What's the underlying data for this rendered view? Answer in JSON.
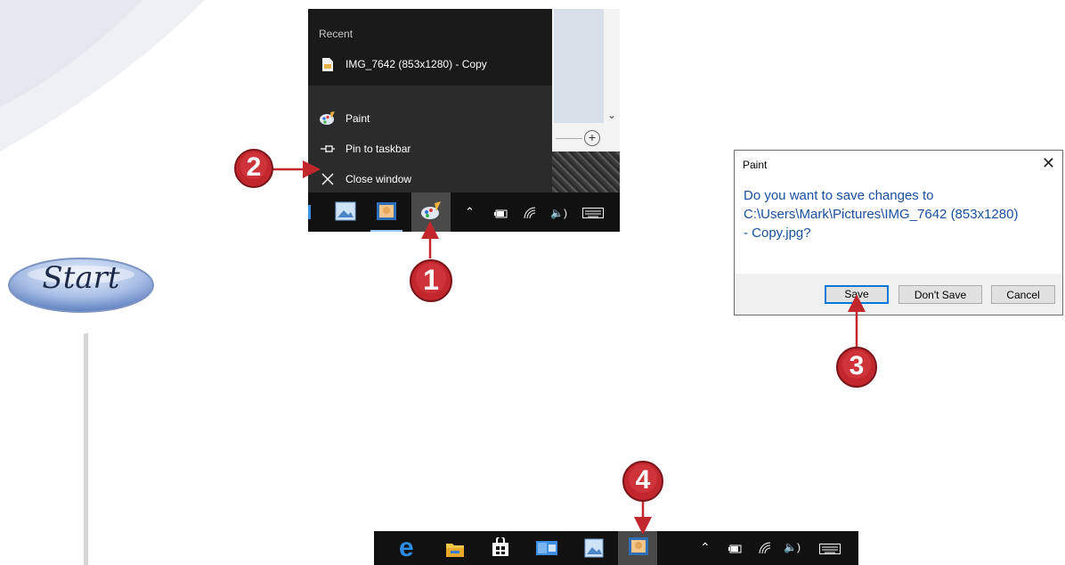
{
  "start_badge": {
    "label": "Start"
  },
  "jump_list": {
    "section_title": "Recent",
    "recent_file": "IMG_7642 (853x1280) - Copy",
    "app_name": "Paint",
    "pin_label": "Pin to taskbar",
    "close_label": "Close window"
  },
  "dialog": {
    "title": "Paint",
    "message_line1": "Do you want to save changes to",
    "message_line2": "C:\\Users\\Mark\\Pictures\\IMG_7642 (853x1280)",
    "message_line3": "- Copy.jpg?",
    "save_label": "Save",
    "dont_save_label": "Don't Save",
    "cancel_label": "Cancel"
  },
  "callouts": [
    "1",
    "2",
    "3",
    "4"
  ],
  "colors": {
    "callout_red": "#c1272d",
    "dialog_text_blue": "#1a4fa0",
    "focus_blue": "#0078d7",
    "taskbar_bg": "#111111"
  }
}
